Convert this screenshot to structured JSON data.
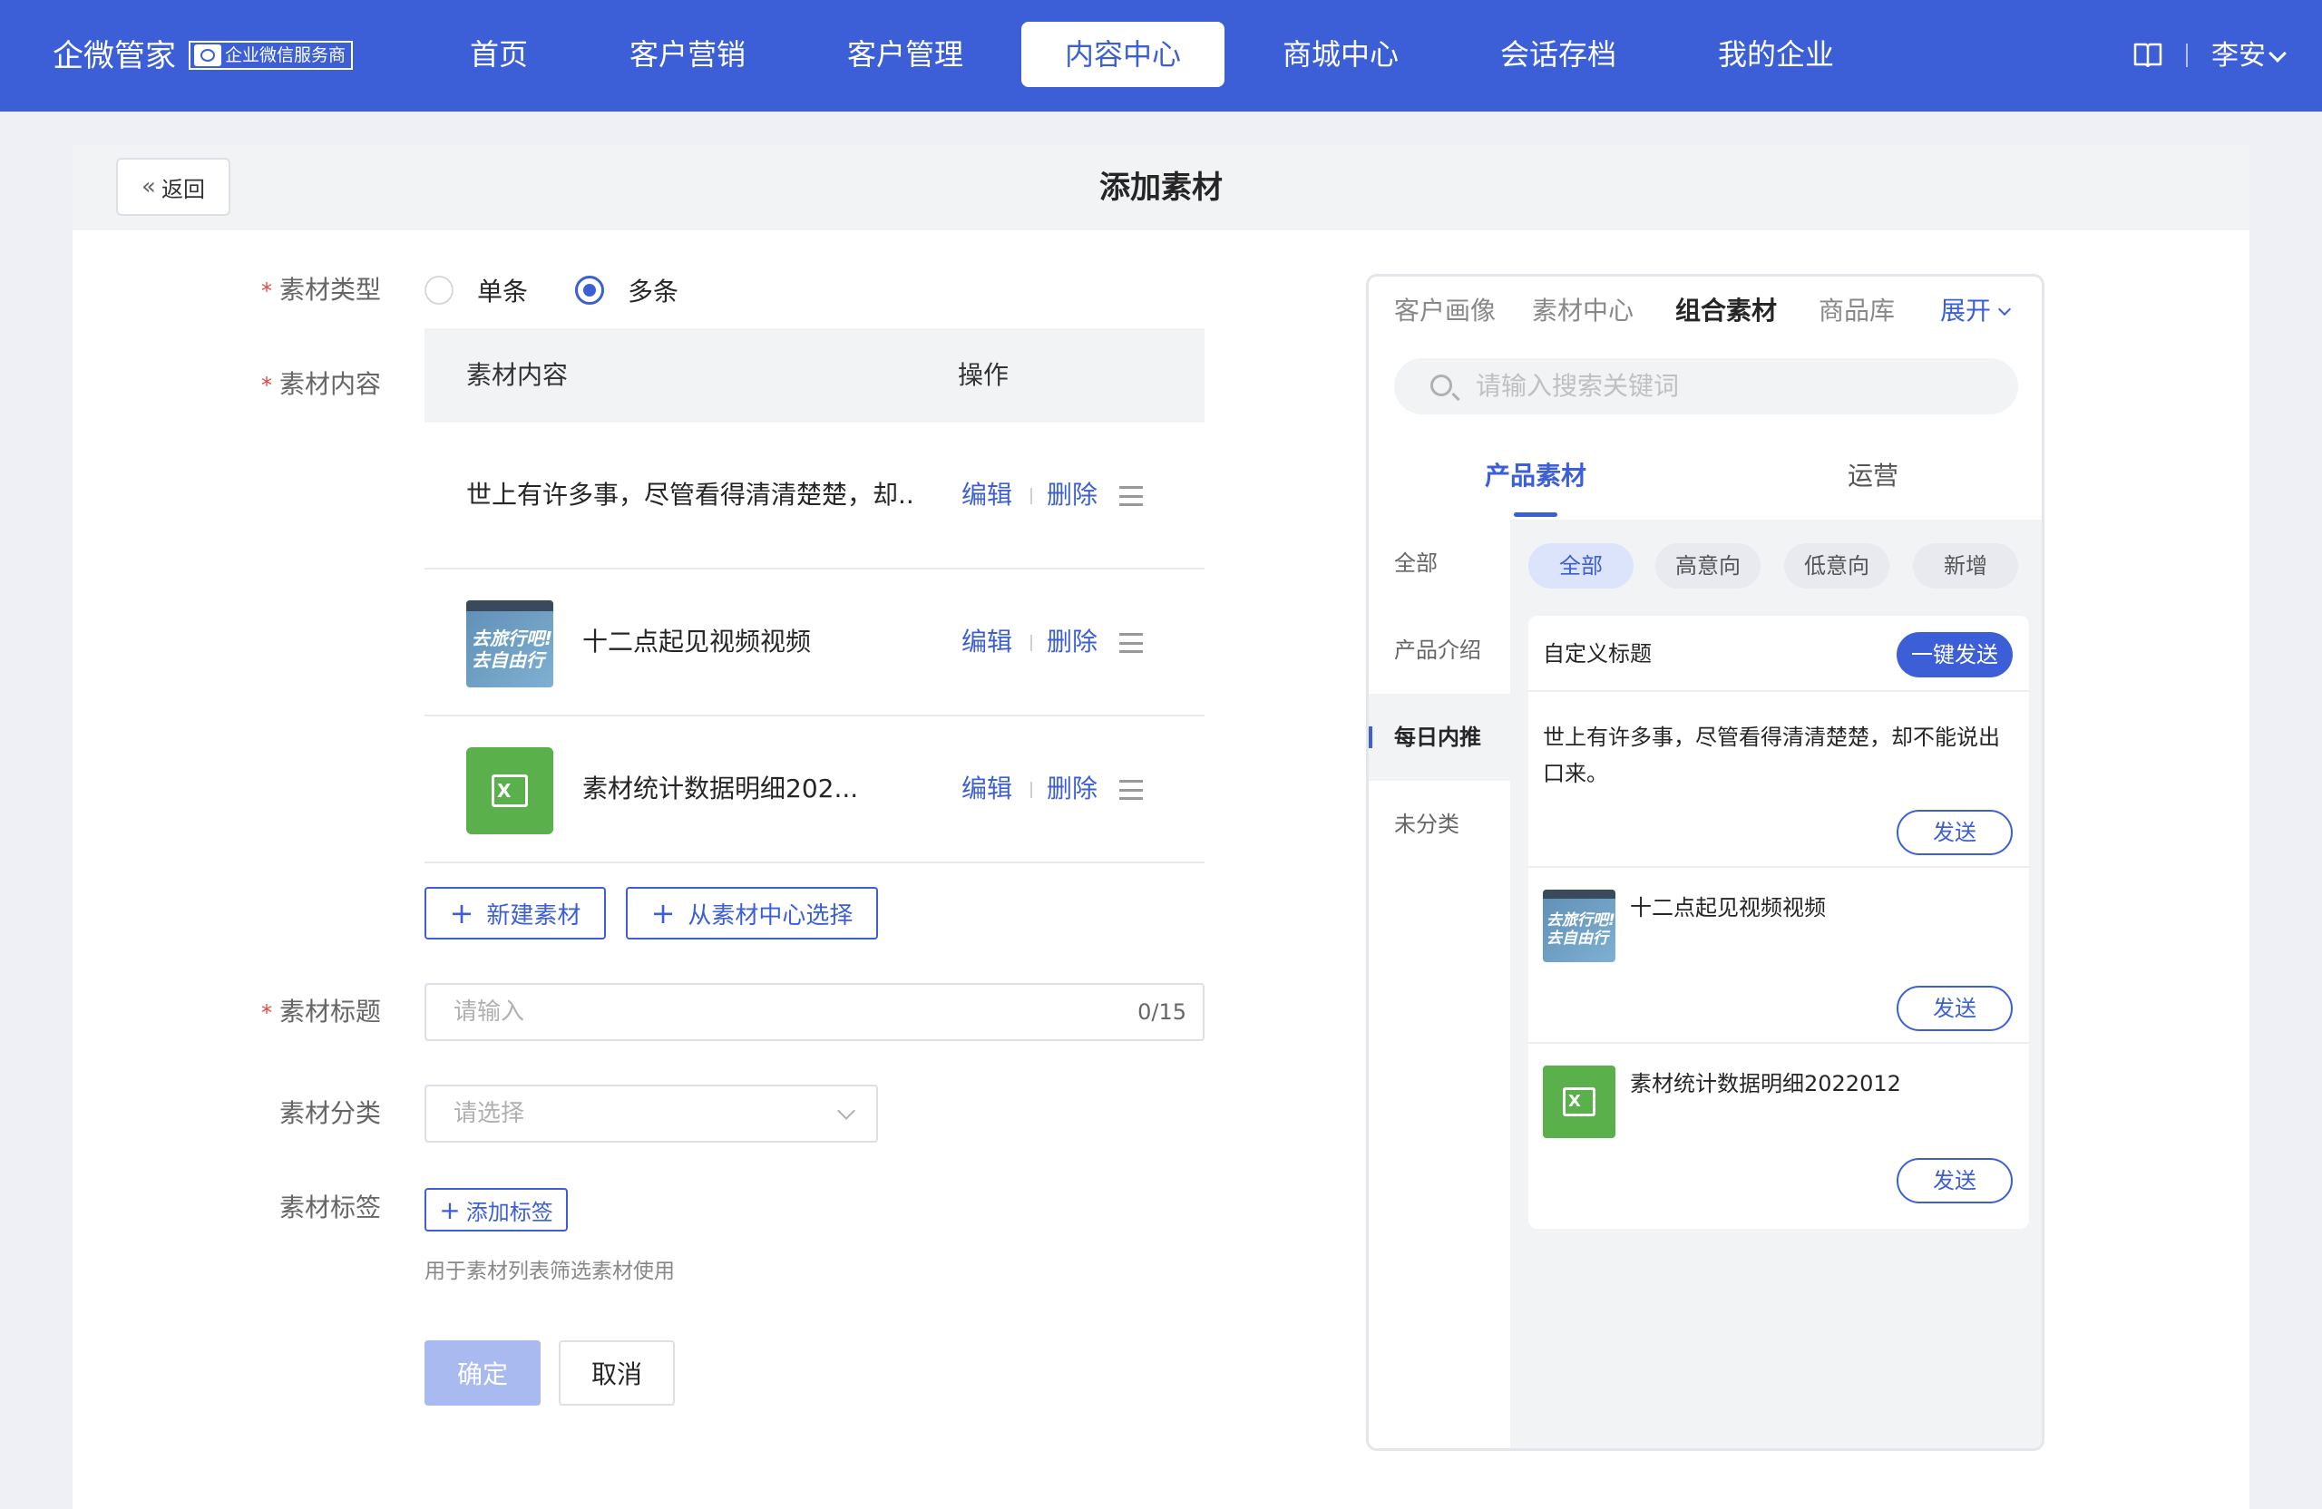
{
  "nav": {
    "brand": "企微管家",
    "badge": "企业微信服务商",
    "items": [
      "首页",
      "客户营销",
      "客户管理",
      "内容中心",
      "商城中心",
      "会话存档",
      "我的企业"
    ],
    "active_index": 3,
    "user": "李安"
  },
  "header": {
    "back_label": "返回",
    "title": "添加素材"
  },
  "form": {
    "type_label": "素材类型",
    "type_options": [
      "单条",
      "多条"
    ],
    "type_selected": "多条",
    "content_label": "素材内容",
    "table_headers": [
      "素材内容",
      "操作"
    ],
    "rows": [
      {
        "kind": "text",
        "text": "世上有许多事，尽管看得清清楚楚，却..",
        "edit": "编辑",
        "delete": "删除"
      },
      {
        "kind": "image",
        "thumb_text": "去旅行吧!\n去自由行",
        "text": "十二点起见视频视频",
        "edit": "编辑",
        "delete": "删除"
      },
      {
        "kind": "excel",
        "thumb_text": "X",
        "text": "素材统计数据明细202...",
        "edit": "编辑",
        "delete": "删除"
      }
    ],
    "new_material": "新建素材",
    "from_center": "从素材中心选择",
    "title_label": "素材标题",
    "title_placeholder": "请输入",
    "title_count": "0/15",
    "category_label": "素材分类",
    "category_placeholder": "请选择",
    "tag_label": "素材标签",
    "add_tag": "添加标签",
    "tag_hint": "用于素材列表筛选素材使用",
    "confirm": "确定",
    "cancel": "取消"
  },
  "preview": {
    "tabs": [
      "客户画像",
      "素材中心",
      "组合素材",
      "商品库"
    ],
    "active_tab": "组合素材",
    "expand": "展开",
    "search_placeholder": "请输入搜索关键词",
    "subtabs": [
      "产品素材",
      "运营"
    ],
    "sidebar": [
      "全部",
      "产品介绍",
      "每日内推",
      "未分类"
    ],
    "chips": [
      "全部",
      "高意向",
      "低意向",
      "新增"
    ],
    "card_title": "自定义标题",
    "send_all": "一键发送",
    "items": [
      {
        "text": "世上有许多事，尽管看得清清楚楚，却不能说出口来。",
        "send": "发送"
      },
      {
        "title": "十二点起见视频视频",
        "thumb_text": "去旅行吧!\n去自由行",
        "send": "发送"
      },
      {
        "title": "素材统计数据明细2022012",
        "thumb_text": "X",
        "send": "发送"
      }
    ]
  },
  "icons": [
    "book-icon",
    "chevron-down-icon",
    "back-chevron-icon",
    "plus-icon",
    "drag-handle-icon",
    "search-icon",
    "image-thumbnail",
    "excel-icon"
  ],
  "colors": {
    "primary": "#3c5fd7",
    "required": "#e94545",
    "confirm_disabled": "#a9baf0",
    "excel_green": "#5ab04a"
  }
}
